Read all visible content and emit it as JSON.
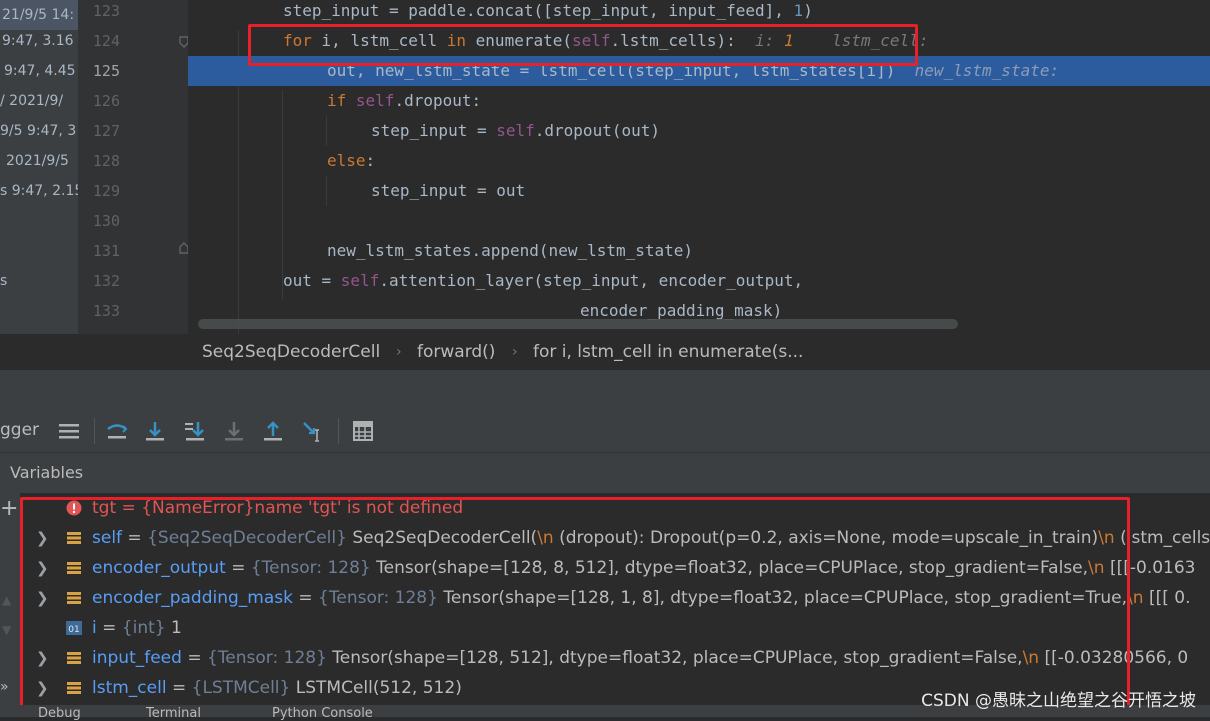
{
  "recent_list": [
    {
      "text": "21/9/5 14:",
      "row": 0
    },
    {
      "text": "9:47, 3.16",
      "row": 1
    },
    {
      "text": "9:47, 4.45",
      "row": 2
    },
    {
      "text": "/ 2021/9/",
      "row": 3
    },
    {
      "text": "9/5 9:47, 3",
      "row": 4
    },
    {
      "text": "2021/9/5",
      "row": 5
    },
    {
      "text": "s 9:47, 2.15",
      "row": 6
    }
  ],
  "left_partial_s": "s",
  "line_numbers": [
    "123",
    "124",
    "125",
    "126",
    "127",
    "128",
    "129",
    "130",
    "131",
    "132",
    "133"
  ],
  "current_line": "125",
  "code": {
    "l123": {
      "a": "step_input = paddle.concat([step_input, input_feed], ",
      "n": "1",
      "b": ")"
    },
    "l124": {
      "for": "for",
      "a": " i, lstm_cell ",
      "in": "in",
      "b": " enumerate(",
      "self": "self",
      "c": ".lstm_cells):",
      "hint1": "i: ",
      "hintval": "1",
      "hint2": "lstm_cell:"
    },
    "l125": {
      "a": "out, new_lstm_state = lstm_cell(step_input, lstm_states[i])",
      "hint": "new_lstm_state:"
    },
    "l126": {
      "if": "if",
      "self": "self",
      "a": ".dropout:"
    },
    "l127": {
      "a": "step_input = ",
      "self": "self",
      "b": ".dropout(out)"
    },
    "l128": {
      "else": "else",
      "a": ":"
    },
    "l129": {
      "a": "step_input = out"
    },
    "l131": {
      "a": "new_lstm_states.append(new_lstm_state)"
    },
    "l132": {
      "a": "out = ",
      "self": "self",
      "b": ".attention_layer(step_input, encoder_output,"
    },
    "l133": {
      "a": "encoder_padding_mask)"
    }
  },
  "breadcrumb": [
    "Seq2SeqDecoderCell",
    "forward()",
    "for i, lstm_cell in enumerate(s..."
  ],
  "debugger_tab": "gger",
  "variables_header": "Variables",
  "variables": [
    {
      "name": "tgt",
      "eq": " = ",
      "type": "{NameError}",
      "value": "name 'tgt' is not defined",
      "kind": "error"
    },
    {
      "name": "self",
      "eq": " = ",
      "type": "{Seq2SeqDecoderCell}",
      "value": " Seq2SeqDecoderCell(",
      "nl1": "\\n",
      "value2": "  (dropout): Dropout(p=0.2, axis=None, mode=upscale_in_train)",
      "nl2": "\\n",
      "value3": "  (lstm_cells",
      "kind": "obj"
    },
    {
      "name": "encoder_output",
      "eq": " = ",
      "type": "{Tensor: 128}",
      "value": " Tensor(shape=[128, 8, 512], dtype=float32, place=CPUPlace, stop_gradient=False,",
      "nl1": "\\n",
      "value2": "       [[[-0.0163",
      "kind": "obj"
    },
    {
      "name": "encoder_padding_mask",
      "eq": " = ",
      "type": "{Tensor: 128}",
      "value": " Tensor(shape=[128, 1, 8], dtype=float32, place=CPUPlace, stop_gradient=True,",
      "nl1": "\\n",
      "value2": "       [[[ 0.",
      "kind": "obj"
    },
    {
      "name": "i",
      "eq": " = ",
      "type": "{int}",
      "value": " 1",
      "kind": "int"
    },
    {
      "name": "input_feed",
      "eq": " = ",
      "type": "{Tensor: 128}",
      "value": " Tensor(shape=[128, 512], dtype=float32, place=CPUPlace, stop_gradient=False,",
      "nl1": "\\n",
      "value2": "       [[-0.03280566,  0",
      "kind": "obj"
    },
    {
      "name": "lstm_cell",
      "eq": " = ",
      "type": "{LSTMCell}",
      "value": " LSTMCell(512, 512)",
      "kind": "obj"
    }
  ],
  "bottom_tabs": [
    "Debug",
    "Terminal",
    "Python Console"
  ],
  "watermark": "CSDN @愚昧之山绝望之谷开悟之坡",
  "colors": {
    "highlight": "#2d5c9e",
    "annotation_box": "#e8202a",
    "keyword": "#cc7832",
    "self": "#94558d"
  }
}
